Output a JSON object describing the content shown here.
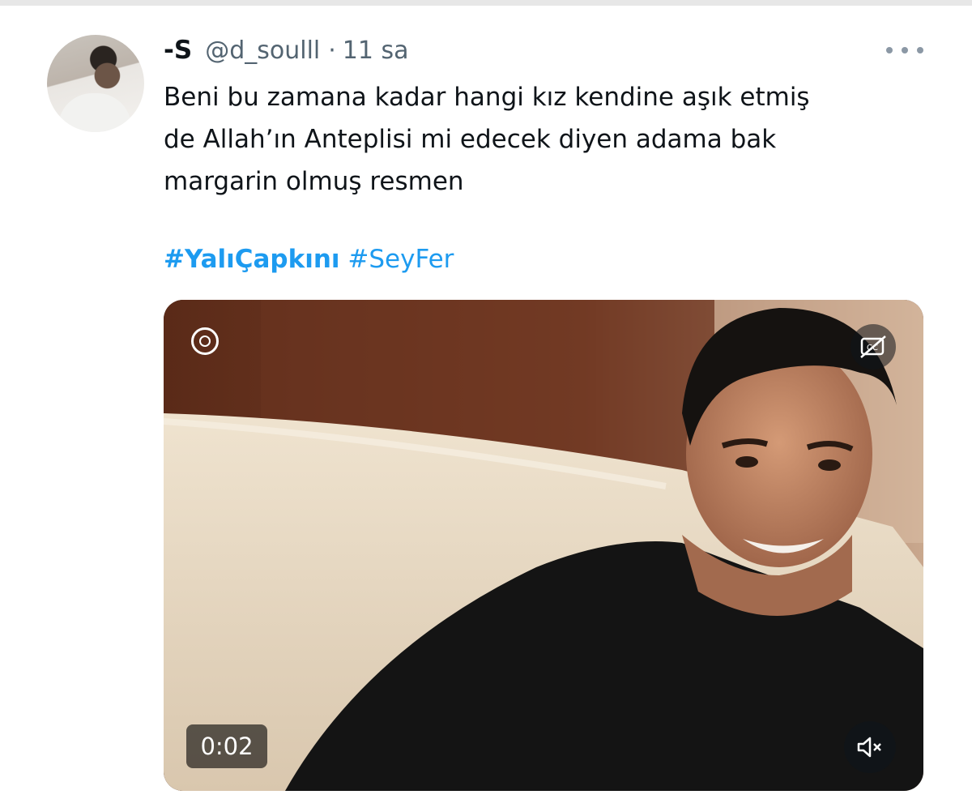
{
  "tweet": {
    "author": {
      "display_name": "-S",
      "handle": "@d_soulll",
      "separator": "·",
      "timestamp": "11 sa"
    },
    "text": "Beni bu zamana kadar hangi kız kendine aşık etmiş\nde Allah’ın Anteplisi mi edecek diyen adama bak\nmargarin olmuş resmen",
    "hashtags": [
      "#YalıÇapkını",
      "#SeyFer"
    ],
    "video": {
      "duration": "0:02",
      "muted": true,
      "icons": {
        "top_left": "gif-sticker-icon",
        "captions": "captions-off-icon",
        "mute": "volume-muted-icon"
      }
    }
  },
  "colors": {
    "link": "#1d9bf0",
    "secondary_text": "#536471",
    "primary_text": "#0f1419"
  }
}
